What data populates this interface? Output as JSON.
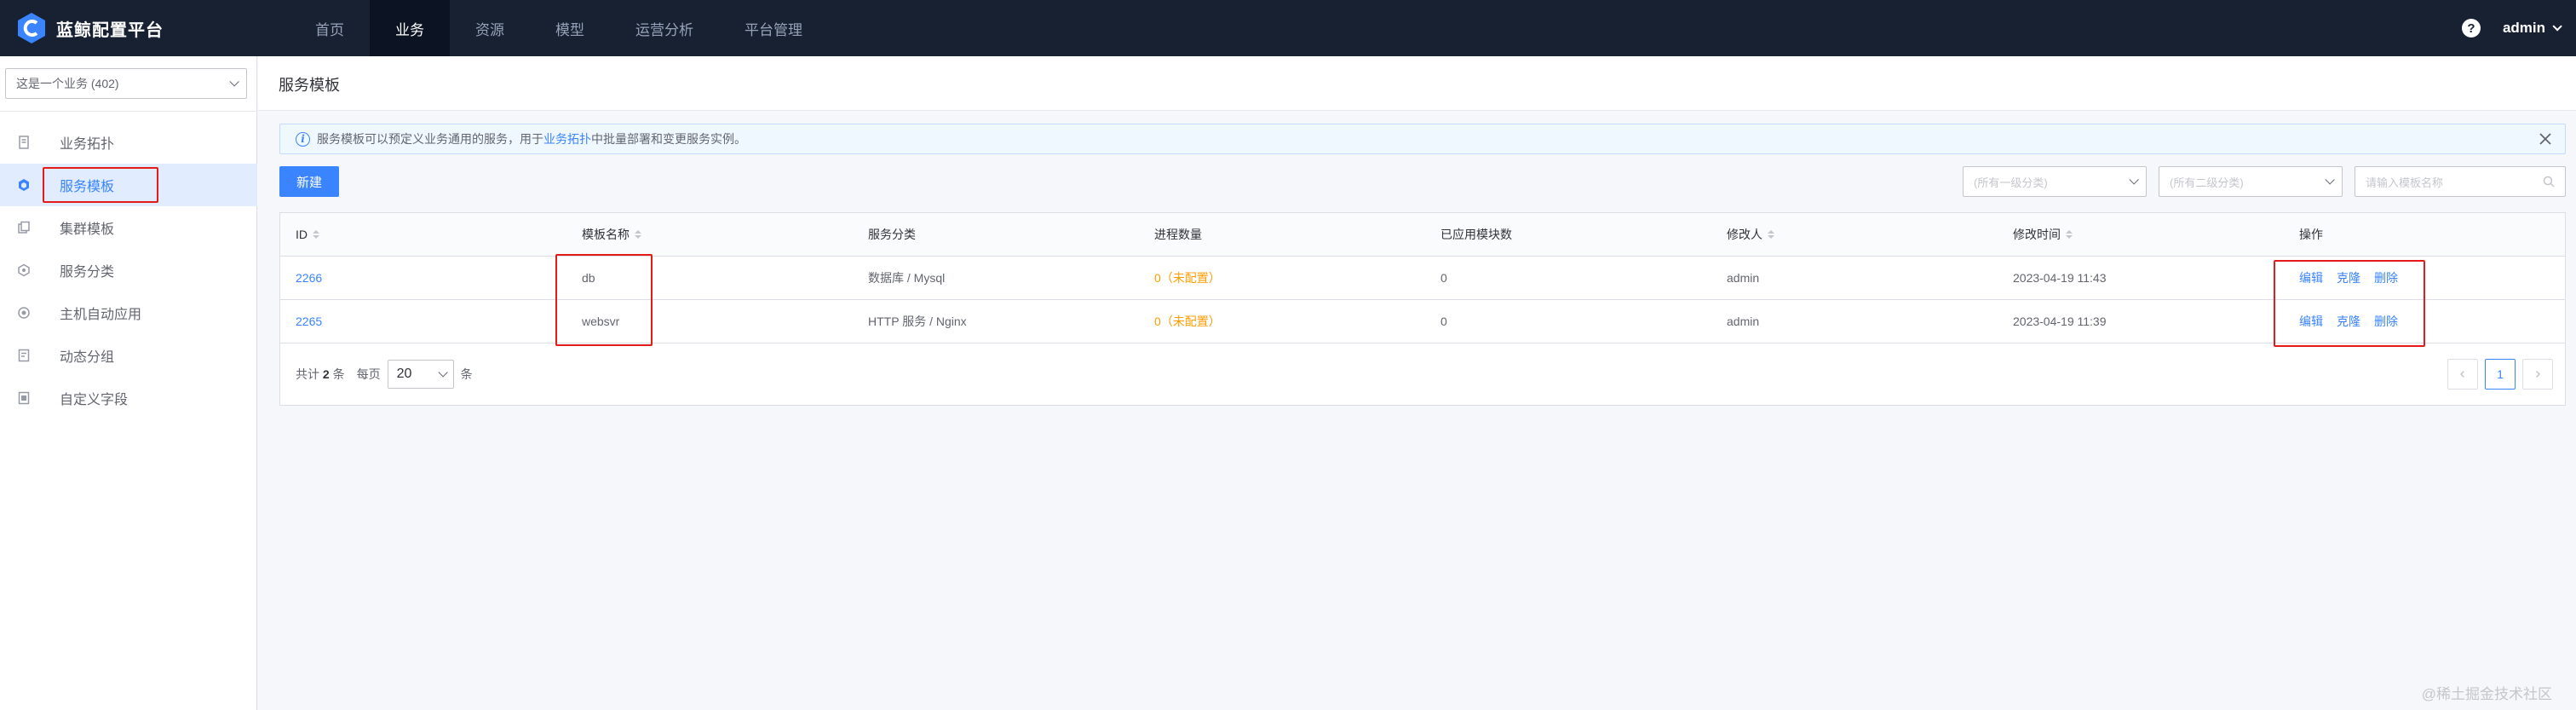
{
  "app": {
    "title": "蓝鲸配置平台"
  },
  "nav": {
    "items": [
      {
        "label": "首页"
      },
      {
        "label": "业务"
      },
      {
        "label": "资源"
      },
      {
        "label": "模型"
      },
      {
        "label": "运营分析"
      },
      {
        "label": "平台管理"
      }
    ],
    "active": "业务"
  },
  "user": {
    "help_icon": "?",
    "name": "admin"
  },
  "sidebar": {
    "business_select": "这是一个业务 (402)",
    "items": [
      {
        "label": "业务拓扑",
        "icon": "topology-icon"
      },
      {
        "label": "服务模板",
        "icon": "service-template-icon"
      },
      {
        "label": "集群模板",
        "icon": "cluster-template-icon"
      },
      {
        "label": "服务分类",
        "icon": "service-category-icon"
      },
      {
        "label": "主机自动应用",
        "icon": "host-auto-apply-icon"
      },
      {
        "label": "动态分组",
        "icon": "dynamic-group-icon"
      },
      {
        "label": "自定义字段",
        "icon": "custom-field-icon"
      }
    ]
  },
  "page": {
    "title": "服务模板",
    "notice": {
      "prefix": "服务模板可以预定义业务通用的服务，用于",
      "link": "业务拓扑",
      "suffix": "中批量部署和变更服务实例。",
      "info_icon": "i"
    },
    "new_button": "新建",
    "filters": {
      "category1_placeholder": "(所有一级分类)",
      "category2_placeholder": "(所有二级分类)",
      "search_placeholder": "请输入模板名称"
    }
  },
  "table": {
    "columns": [
      "ID",
      "模板名称",
      "服务分类",
      "进程数量",
      "已应用模块数",
      "修改人",
      "修改时间",
      "操作"
    ],
    "rows": [
      {
        "id": "2266",
        "name": "db",
        "category": "数据库 / Mysql",
        "process": "0（未配置）",
        "modules": "0",
        "modifier": "admin",
        "time": "2023-04-19 11:43"
      },
      {
        "id": "2265",
        "name": "websvr",
        "category": "HTTP 服务 / Nginx",
        "process": "0（未配置）",
        "modules": "0",
        "modifier": "admin",
        "time": "2023-04-19 11:39"
      }
    ],
    "ops": {
      "edit": "编辑",
      "clone": "克隆",
      "delete": "删除"
    }
  },
  "pagination": {
    "total_prefix": "共计",
    "total": "2",
    "total_suffix": "条",
    "per_page_label": "每页",
    "page_size": "20",
    "per_page_suffix": "条",
    "current_page": "1"
  },
  "watermark": "@稀土掘金技术社区",
  "colors": {
    "accent": "#3a84ff",
    "nav_bg": "#182132",
    "warning": "#ff9c01",
    "highlight_box": "#e31b1b"
  }
}
